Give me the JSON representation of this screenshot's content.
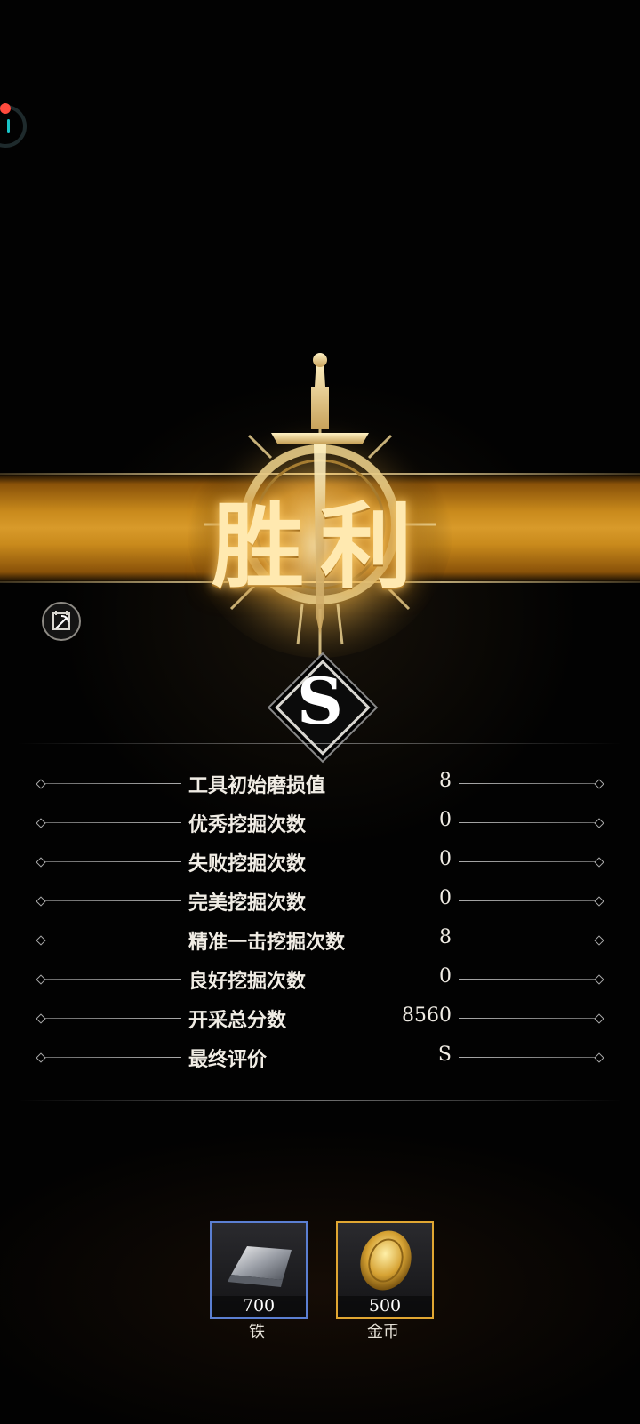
{
  "header": {
    "title": "胜利"
  },
  "grade": {
    "letter": "S"
  },
  "stats": [
    {
      "label": "工具初始磨损值",
      "value": "8"
    },
    {
      "label": "优秀挖掘次数",
      "value": "0"
    },
    {
      "label": "失败挖掘次数",
      "value": "0"
    },
    {
      "label": "完美挖掘次数",
      "value": "0"
    },
    {
      "label": "精准一击挖掘次数",
      "value": "8"
    },
    {
      "label": "良好挖掘次数",
      "value": "0"
    },
    {
      "label": "开采总分数",
      "value": "8560"
    },
    {
      "label": "最终评价",
      "value": "S"
    }
  ],
  "rewards": [
    {
      "name": "铁",
      "count": "700",
      "icon": "iron-ingot-icon",
      "frame_color": "#5b7fd2"
    },
    {
      "name": "金币",
      "count": "500",
      "icon": "gold-coin-icon",
      "frame_color": "#e0a632"
    }
  ],
  "icons": {
    "side": "pickaxe-calendar-icon",
    "status": "status-ring-icon"
  },
  "colors": {
    "banner_gold": "#c98a1c",
    "title_glow": "#ffcf6a",
    "status_dot": "#ff4a3d",
    "status_ring": "#19c4c8"
  }
}
